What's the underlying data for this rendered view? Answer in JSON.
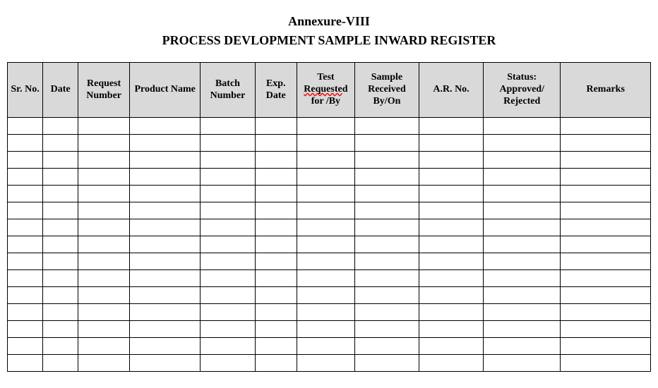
{
  "header": {
    "annexure": "Annexure-VIII",
    "title": "PROCESS DEVLOPMENT SAMPLE INWARD REGISTER"
  },
  "columns": {
    "c1": "Sr. No.",
    "c2": "Date",
    "c3": "Request Number",
    "c4": "Product Name",
    "c5": "Batch Number",
    "c6": "Exp. Date",
    "c7a": "Test ",
    "c7b": "Requeste",
    "c7c": "d for /By",
    "c8": "Sample Received By/On",
    "c9": "A.R. No.",
    "c10": "Status: Approved/ Rejected",
    "c11": "Remarks"
  },
  "rows": [
    {},
    {},
    {},
    {},
    {},
    {},
    {},
    {},
    {},
    {},
    {},
    {},
    {},
    {},
    {}
  ]
}
